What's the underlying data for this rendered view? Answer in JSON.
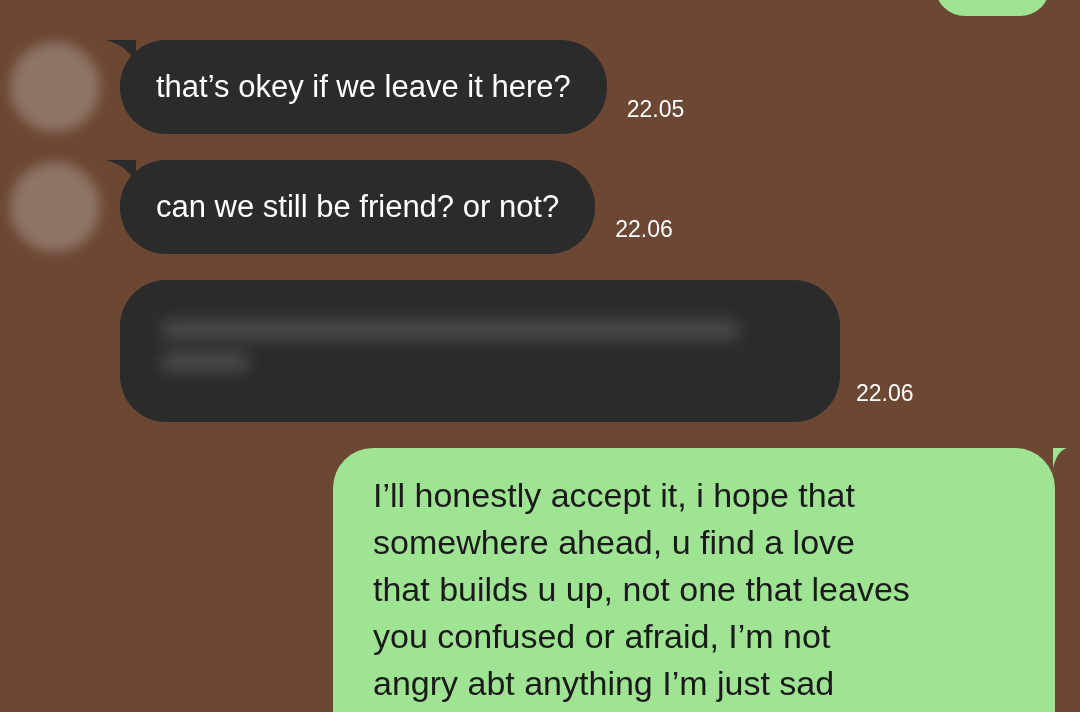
{
  "messages": [
    {
      "kind": "sent_fragment"
    },
    {
      "kind": "received",
      "avatar": true,
      "text": "that’s okey if we leave it here?",
      "time": "22.05"
    },
    {
      "kind": "received",
      "avatar": true,
      "text": "can we still be friend? or not?",
      "time": "22.06"
    },
    {
      "kind": "blurred",
      "avatar": false,
      "time": "22.06"
    },
    {
      "kind": "sent",
      "lines": [
        "I’ll honestly accept it, i hope that",
        "somewhere ahead, u find a love",
        "that builds u up, not one that leaves",
        "you confused or afraid, I’m not",
        "angry abt anything I’m just sad"
      ]
    }
  ]
}
